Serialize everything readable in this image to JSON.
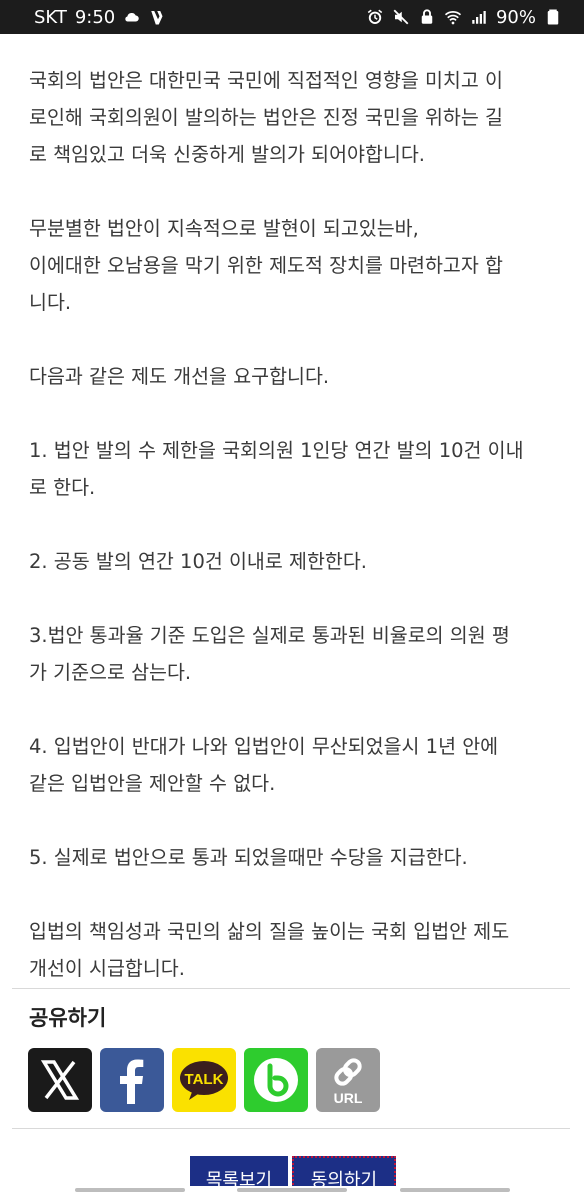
{
  "status_bar": {
    "carrier": "SKT",
    "time": "9:50",
    "battery": "90%",
    "icons": [
      "cloud-icon",
      "app-v-icon",
      "alarm-icon",
      "mute-icon",
      "lock-icon",
      "wifi-icon",
      "signal-icon",
      "battery-icon"
    ]
  },
  "article": {
    "paragraphs": [
      [
        "국회의 법안은 대한민국 국민에 직접적인 영향을 미치고 이",
        "로인해 국회의원이 발의하는 법안은 진정 국민을 위하는 길",
        "로 책임있고 더욱 신중하게 발의가 되어야합니다."
      ],
      [
        "무분별한 법안이 지속적으로 발현이 되고있는바,",
        "이에대한 오남용을 막기 위한 제도적 장치를 마련하고자 합",
        "니다."
      ],
      [
        "다음과 같은 제도 개선을 요구합니다."
      ],
      [
        "1. 법안 발의 수 제한을 국회의원 1인당 연간 발의 10건 이내",
        "로 한다."
      ],
      [
        "2. 공동 발의 연간 10건 이내로 제한한다."
      ],
      [
        "3.법안 통과율 기준 도입은 실제로 통과된 비율로의 의원 평",
        "가 기준으로 삼는다."
      ],
      [
        "4. 입법안이 반대가 나와 입법안이 무산되었을시 1년 안에",
        "같은 입법안을 제안할 수 없다."
      ],
      [
        "5. 실제로 법안으로 통과 되었을때만 수당을 지급한다."
      ],
      [
        "입법의 책임성과 국민의 삶의 질을 높이는 국회 입법안 제도",
        "개선이 시급합니다."
      ]
    ]
  },
  "share": {
    "title": "공유하기",
    "buttons": [
      {
        "name": "share-x-button",
        "icon": "x-icon",
        "color": "#1a1a1a"
      },
      {
        "name": "share-facebook-button",
        "icon": "facebook-icon",
        "color": "#3b5998"
      },
      {
        "name": "share-kakaotalk-button",
        "icon": "kakaotalk-icon",
        "label": "TALK",
        "color": "#fae100"
      },
      {
        "name": "share-band-button",
        "icon": "band-icon",
        "color": "#2ecc2e"
      },
      {
        "name": "share-url-button",
        "icon": "link-icon",
        "label": "URL",
        "color": "#9a9a9a"
      }
    ]
  },
  "actions": {
    "list_label": "목록보기",
    "agree_label": "동의하기",
    "accent": "#1c2f86"
  }
}
